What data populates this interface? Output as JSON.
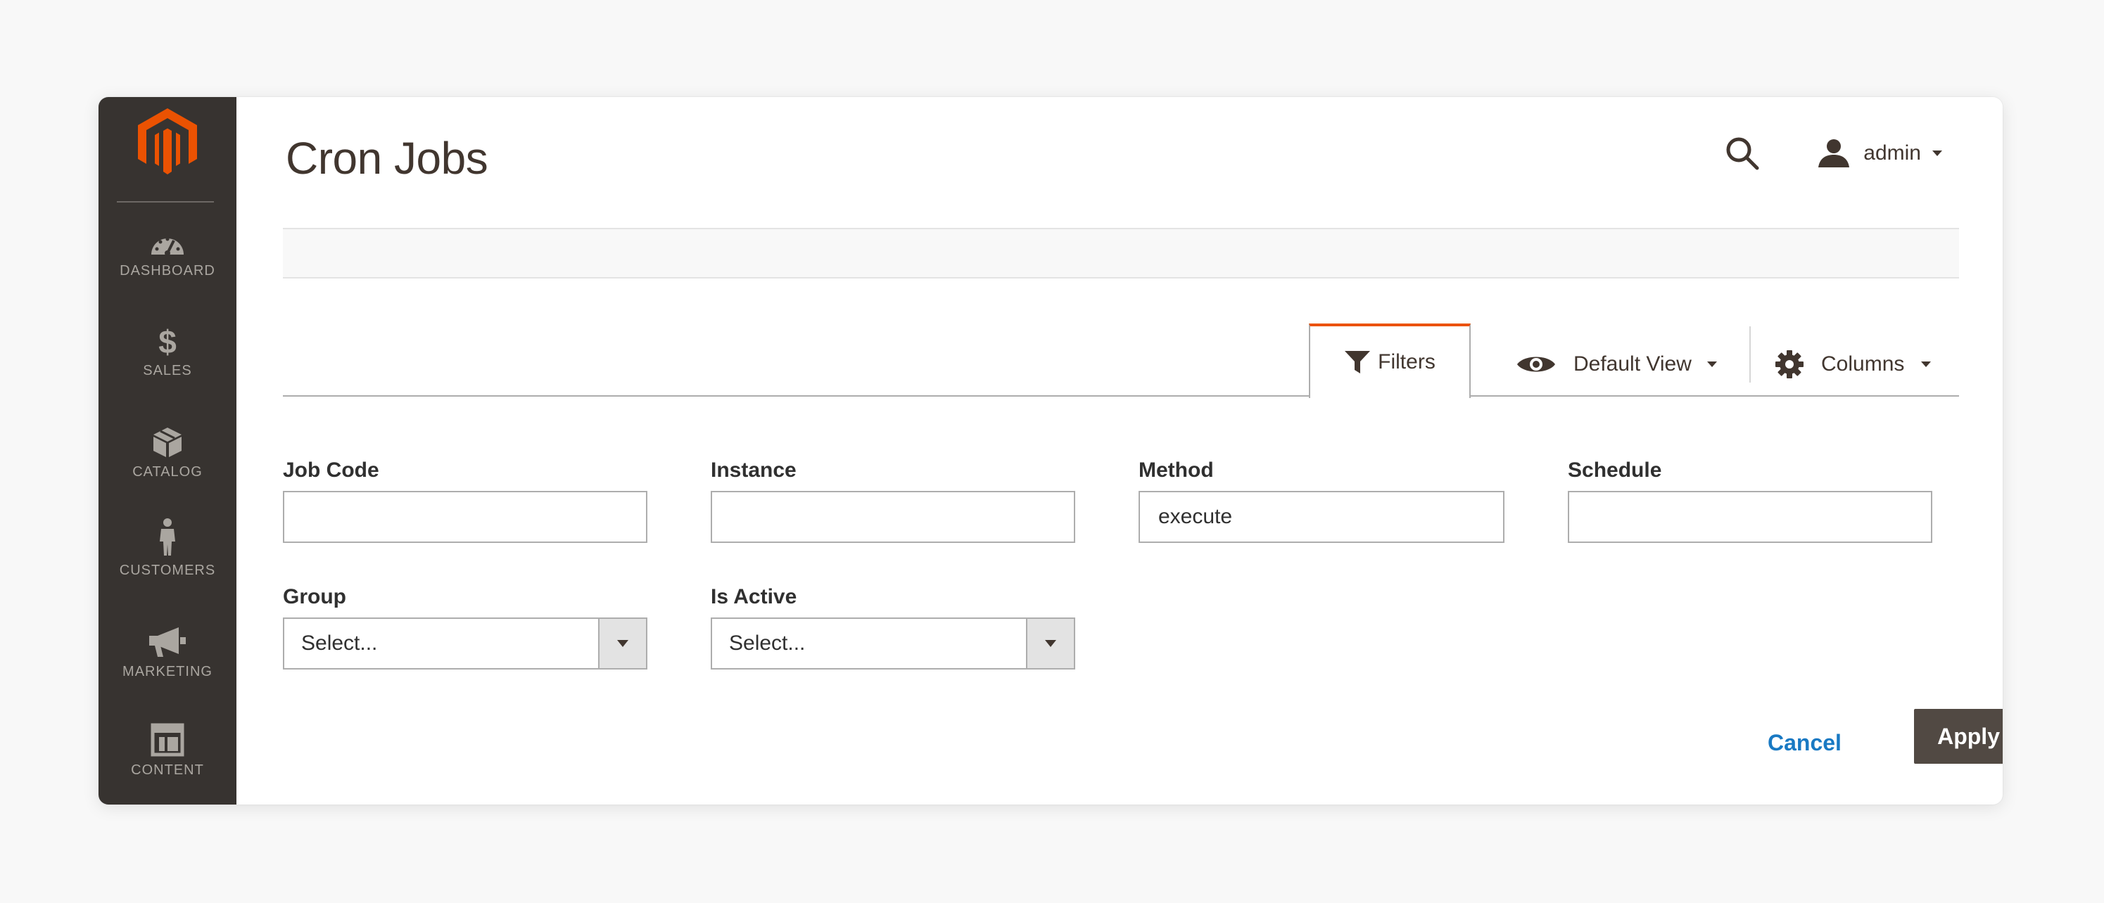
{
  "header": {
    "page_title": "Cron Jobs",
    "user_name": "admin"
  },
  "sidebar": {
    "items": [
      {
        "label": "DASHBOARD",
        "icon": "dashboard-icon"
      },
      {
        "label": "SALES",
        "icon": "dollar-icon"
      },
      {
        "label": "CATALOG",
        "icon": "cube-icon"
      },
      {
        "label": "CUSTOMERS",
        "icon": "person-icon"
      },
      {
        "label": "MARKETING",
        "icon": "megaphone-icon"
      },
      {
        "label": "CONTENT",
        "icon": "layout-icon"
      }
    ]
  },
  "toolbar": {
    "filters_label": "Filters",
    "view_label": "Default View",
    "columns_label": "Columns"
  },
  "filters": {
    "job_code": {
      "label": "Job Code",
      "value": ""
    },
    "instance": {
      "label": "Instance",
      "value": ""
    },
    "method": {
      "label": "Method",
      "value": "execute"
    },
    "schedule": {
      "label": "Schedule",
      "value": ""
    },
    "group": {
      "label": "Group",
      "selected": "Select..."
    },
    "is_active": {
      "label": "Is Active",
      "selected": "Select..."
    }
  },
  "actions": {
    "cancel_label": "Cancel",
    "apply_label": "Apply Filters"
  },
  "colors": {
    "sidebar_bg": "#373330",
    "accent_orange": "#eb5202",
    "primary_button": "#514943",
    "link_blue": "#1979c3"
  }
}
